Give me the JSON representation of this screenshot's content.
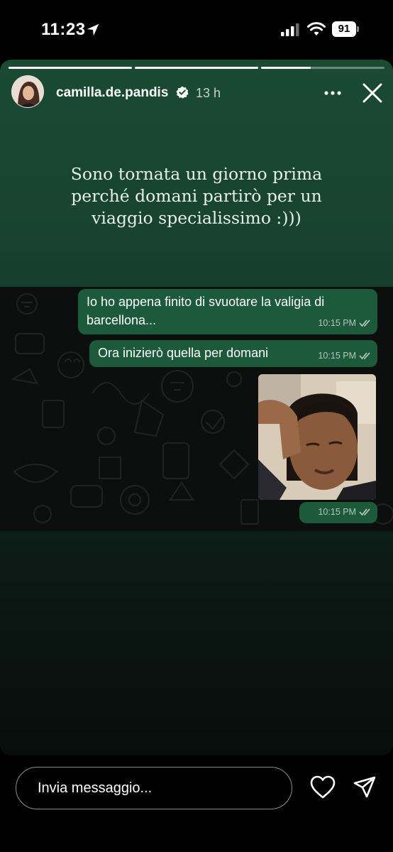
{
  "status_bar": {
    "time": "11:23",
    "battery": "91",
    "icons": [
      "location-arrow-icon",
      "signal-icon",
      "wifi-icon",
      "battery-icon"
    ]
  },
  "story": {
    "progress": [
      1.0,
      1.0,
      0.4
    ],
    "username": "camilla.de.pandis",
    "verified": true,
    "time_ago": "13 h",
    "caption": "Sono tornata un giorno prima perché domani partirò per un viaggio specialissimo :)))",
    "chat": {
      "messages": [
        {
          "text": "Io ho appena finito di svuotare la valigia di\nbarcellona...",
          "time": "10:15 PM"
        },
        {
          "text": "Ora inizierò quella per domani",
          "time": "10:15 PM"
        },
        {
          "type": "photo",
          "time": "10:15 PM"
        }
      ]
    }
  },
  "footer": {
    "input_placeholder": "Invia messaggio...",
    "icons": [
      "heart-icon",
      "send-icon"
    ]
  },
  "colors": {
    "story_green": "#1b4a32",
    "bubble_green": "#1d5a3c",
    "chat_bg": "#0d0f0e",
    "verified_blue": "#ffffff"
  }
}
